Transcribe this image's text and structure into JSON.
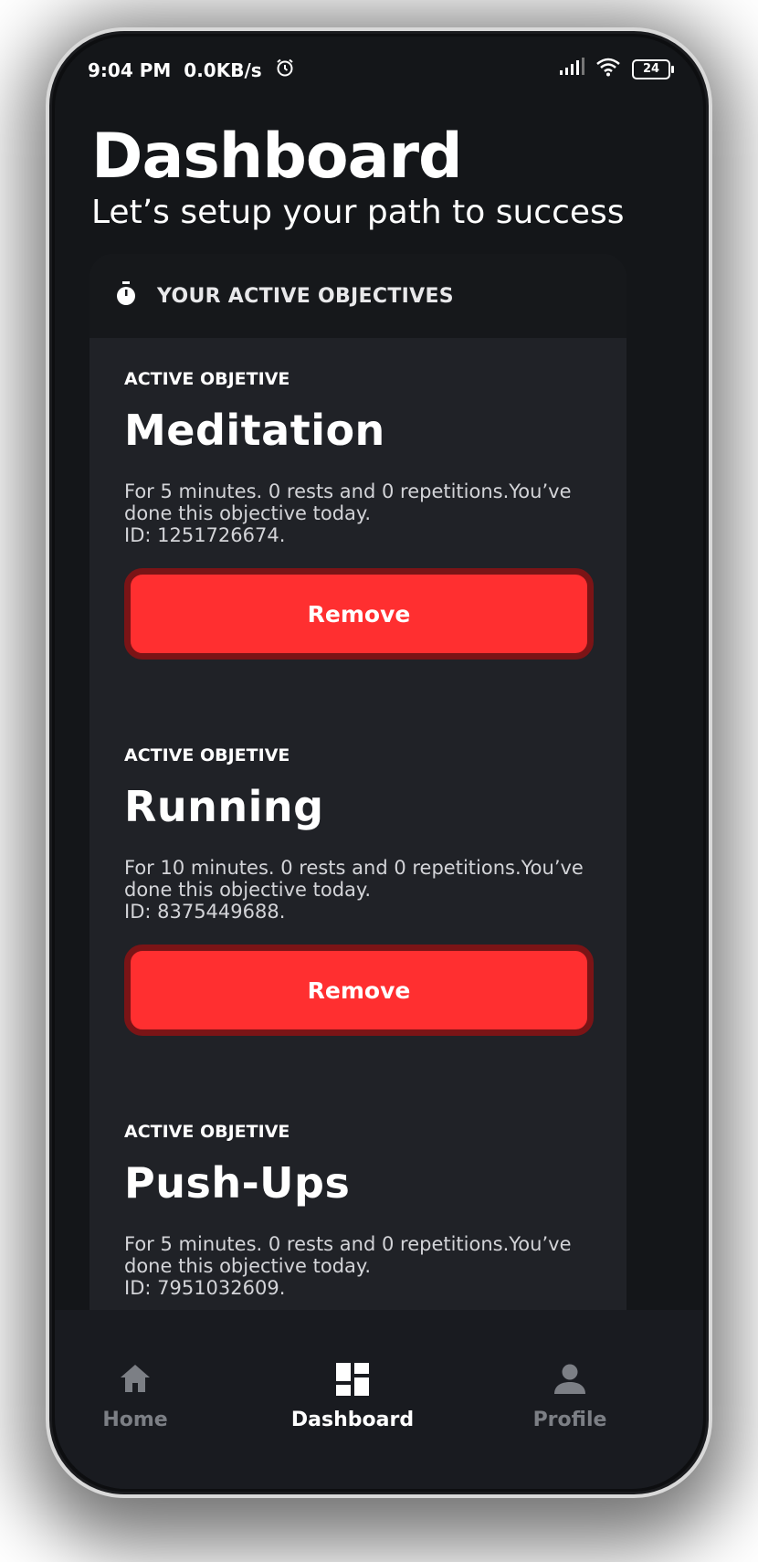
{
  "status_bar": {
    "time": "9:04 PM",
    "network_speed": "0.0KB/s",
    "battery": "24",
    "icons": [
      "alarm-icon",
      "signal-icon",
      "wifi-icon",
      "battery-icon"
    ]
  },
  "header": {
    "title": "Dashboard",
    "subtitle": "Let’s setup your path to success"
  },
  "objectives_card": {
    "title": "YOUR ACTIVE OBJECTIVES",
    "icon": "stopwatch-icon",
    "items": [
      {
        "label": "ACTIVE OBJETIVE",
        "name": "Meditation",
        "description": "For 5 minutes. 0 rests and 0 repetitions.You’ve done this objective today.",
        "id_text": "ID: 1251726674.",
        "button": "Remove"
      },
      {
        "label": "ACTIVE OBJETIVE",
        "name": "Running",
        "description": "For 10 minutes. 0 rests and 0 repetitions.You’ve done this objective today.",
        "id_text": "ID: 8375449688.",
        "button": "Remove"
      },
      {
        "label": "ACTIVE OBJETIVE",
        "name": "Push-Ups",
        "description": "For 5 minutes. 0 rests and 0 repetitions.You’ve done this objective today.",
        "id_text": "ID: 7951032609."
      }
    ]
  },
  "bottom_nav": {
    "items": [
      {
        "label": "Home",
        "icon": "home-icon"
      },
      {
        "label": "Dashboard",
        "icon": "dashboard-icon",
        "active": true
      },
      {
        "label": "Profile",
        "icon": "person-icon"
      }
    ]
  },
  "colors": {
    "background": "#141619",
    "card": "#202227",
    "card_header": "#16181b",
    "accent_red": "#ff2f30",
    "nav_inactive": "#7c7f85"
  }
}
